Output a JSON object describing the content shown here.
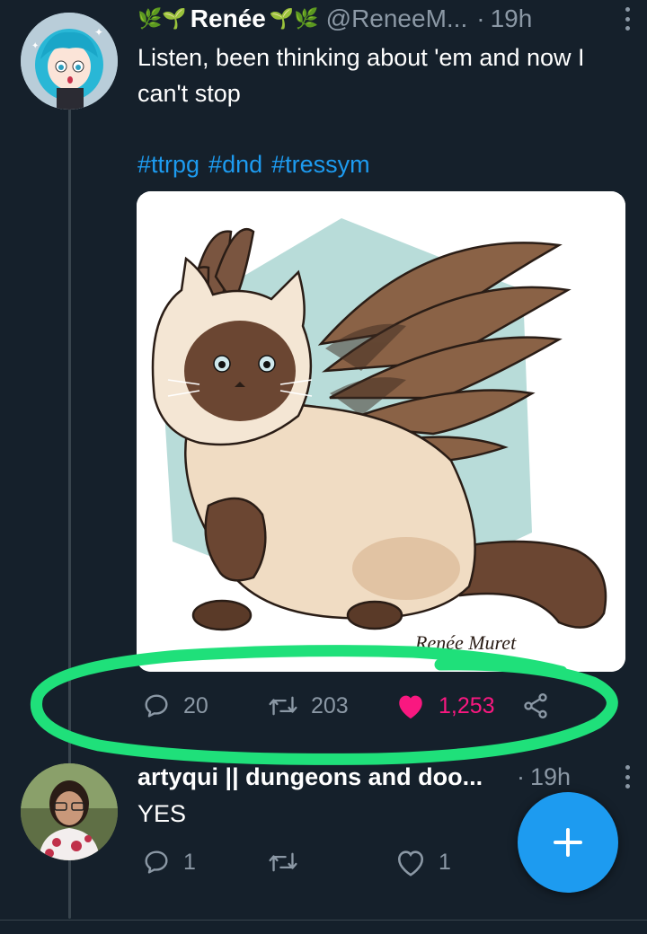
{
  "tweet": {
    "author_emoji_left": "🌿🌱",
    "author_name": "Renée",
    "author_emoji_right": "🌱🌿",
    "handle": "@ReneeM...",
    "separator": "·",
    "time": "19h",
    "text": "Listen, been thinking about 'em and now I can't stop",
    "hashtags": [
      "#ttrpg",
      "#dnd",
      "#tressym"
    ],
    "image_signature": "Renée Muret",
    "actions": {
      "reply_count": "20",
      "retweet_count": "203",
      "like_count": "1,253"
    }
  },
  "reply": {
    "author_name": "artyqui || dungeons and doo...",
    "separator": "·",
    "time": "19h",
    "text": "YES",
    "actions": {
      "reply_count": "1",
      "like_count": "1"
    }
  },
  "colors": {
    "background": "#15202b",
    "link": "#1d9bf0",
    "like": "#f91880",
    "muted": "#8b98a5",
    "annotation": "#1fe07a"
  },
  "icons": [
    "reply-icon",
    "retweet-icon",
    "heart-icon",
    "share-icon",
    "more-icon",
    "compose-plus-icon"
  ]
}
